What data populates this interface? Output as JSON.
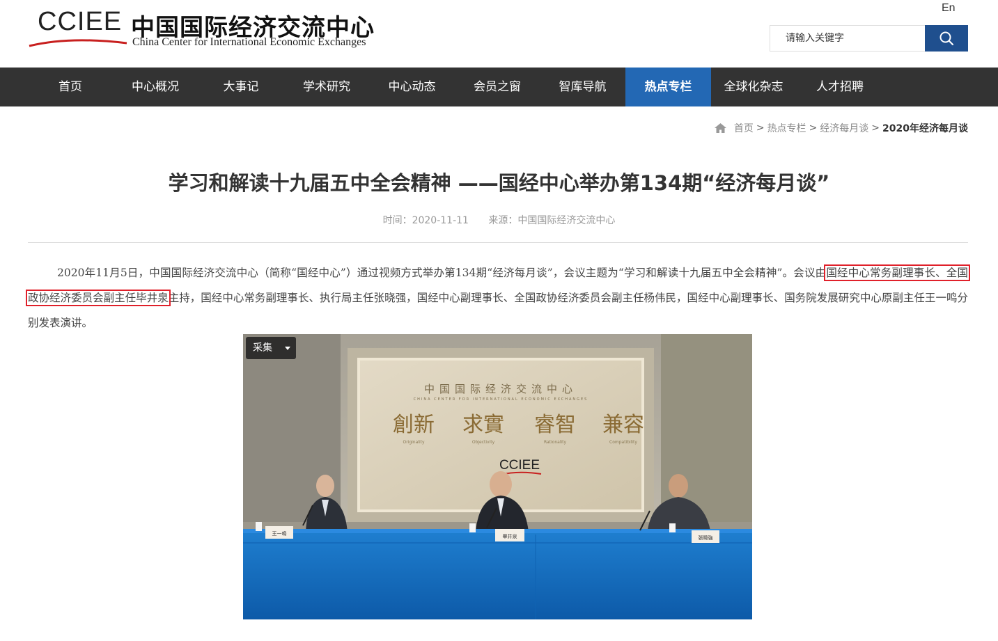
{
  "header": {
    "logo_en": "CCIEE",
    "logo_cn": "中国国际经济交流中心",
    "logo_sub": "China Center for International Economic Exchanges",
    "lang_label": "En",
    "search_placeholder": "请输入关键字",
    "search_icon": "search-icon"
  },
  "nav": {
    "items": [
      {
        "label": "首页"
      },
      {
        "label": "中心概况"
      },
      {
        "label": "大事记"
      },
      {
        "label": "学术研究"
      },
      {
        "label": "中心动态"
      },
      {
        "label": "会员之窗"
      },
      {
        "label": "智库导航"
      },
      {
        "label": "热点专栏",
        "active": true
      },
      {
        "label": "全球化杂志"
      },
      {
        "label": "人才招聘"
      }
    ]
  },
  "breadcrumb": {
    "icon": "home-icon",
    "items": [
      "首页",
      "热点专栏",
      "经济每月谈"
    ],
    "current": "2020年经济每月谈",
    "separator": ">"
  },
  "article": {
    "title": "学习和解读十九届五中全会精神 ——国经中心举办第134期“经济每月谈”",
    "time_label": "时间：2020-11-11",
    "source_label": "来源：中国国际经济交流中心",
    "para_before": "2020年11月5日，中国国际经济交流中心（简称“国经中心”）通过视频方式举办第134期“经济每月谈”，会议主题为“学习和解读十九届五中全会精神”。会议由",
    "para_highlight": "国经中心常务副理事长、全国政协经济委员会副主任毕井泉",
    "para_after": "主持，国经中心常务副理事长、执行局主任张晓强，国经中心副理事长、全国政协经济委员会副主任杨伟民，国经中心副理事长、国务院发展研究中心原副主任王一鸣分别发表演讲。",
    "collect_label": "采集",
    "photo": {
      "wall_title": "中国国际经济交流中心",
      "wall_sub": "CHINA CENTER FOR INTERNATIONAL ECONOMIC EXCHANGES",
      "motto": [
        "創新",
        "求實",
        "睿智",
        "兼容"
      ],
      "motto_en": [
        "Originality",
        "Objectivity",
        "Rationality",
        "Compatibility"
      ],
      "wall_logo": "CCIEE",
      "nameplates": [
        "王一鳴",
        "畢井泉",
        "張曉強"
      ]
    }
  },
  "colors": {
    "nav_bg": "#333333",
    "nav_active": "#2368b4",
    "search_btn": "#1f4f8e",
    "highlight_border": "#e0202a"
  }
}
